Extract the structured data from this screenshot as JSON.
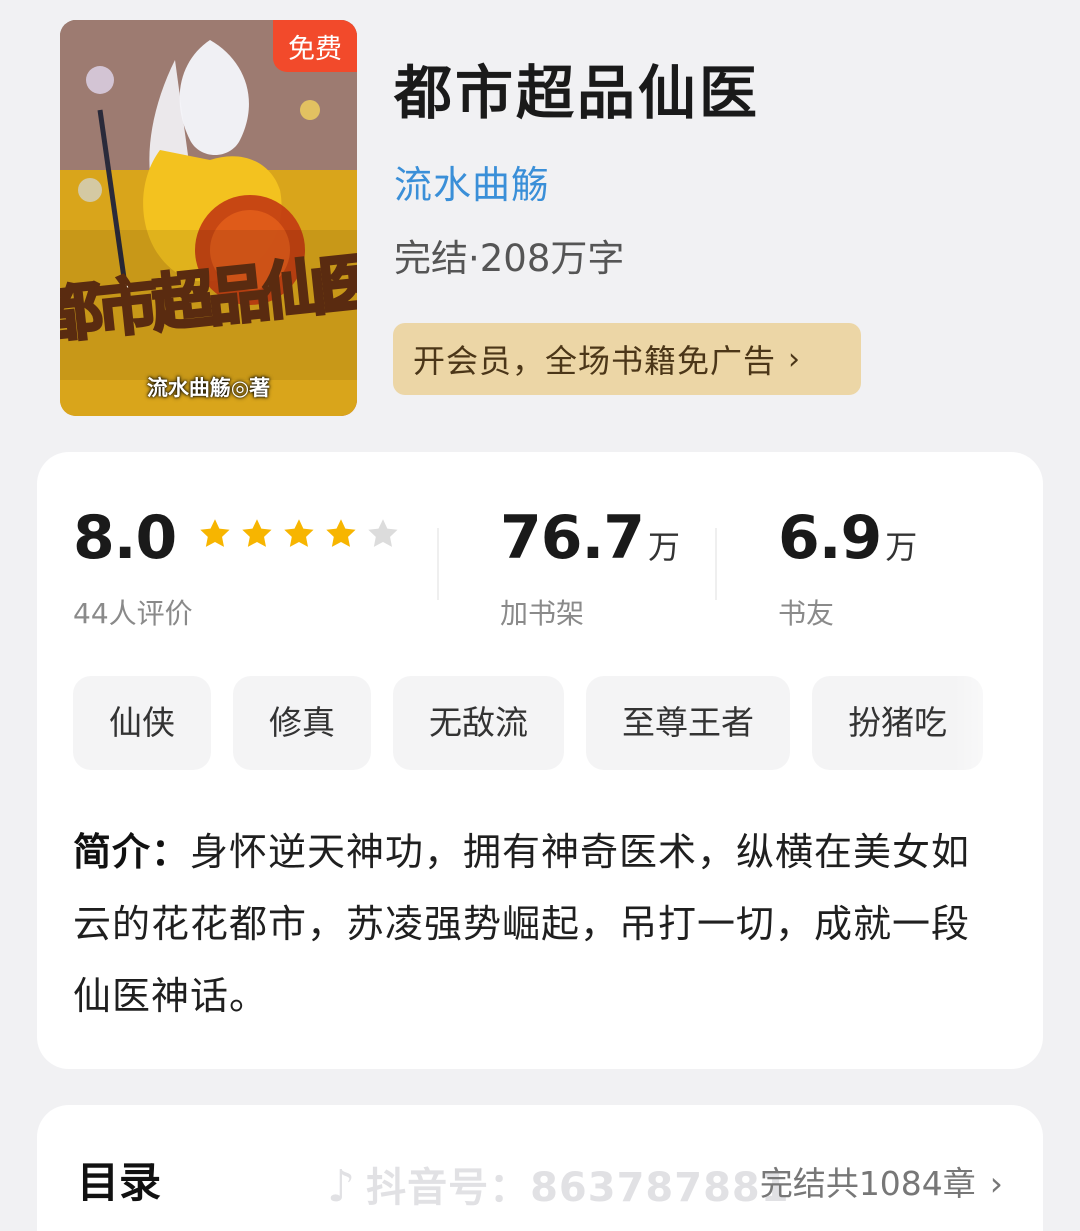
{
  "book": {
    "title": "都市超品仙医",
    "author": "流水曲觞",
    "meta": "完结·208万字",
    "cover": {
      "badge": "免费",
      "art_title": "都市超品仙医",
      "art_author": "流水曲觞◎著"
    }
  },
  "vip_banner": {
    "label": "开会员，全场书籍免广告",
    "chevron": "›",
    "bg_color": "#ecd6a6"
  },
  "stats": {
    "rating": {
      "value": "8.0",
      "stars": 4,
      "max_stars": 5,
      "caption": "44人评价"
    },
    "shelf": {
      "value": "76.7",
      "unit": "万",
      "caption": "加书架"
    },
    "friends": {
      "value": "6.9",
      "unit": "万",
      "caption": "书友"
    }
  },
  "tags": [
    "仙侠",
    "修真",
    "无敌流",
    "至尊王者",
    "扮猪吃"
  ],
  "synopsis": {
    "label": "简介：",
    "text": "身怀逆天神功，拥有神奇医术，纵横在美女如云的花花都市，苏凌强势崛起，吊打一切，成就一段仙医神话。"
  },
  "toc": {
    "title": "目录",
    "status": "完结共1084章",
    "chevron": "›"
  },
  "watermark": {
    "text": "抖音号：863787881",
    "icon": "douyin-logo-icon"
  },
  "colors": {
    "accent_blue": "#3a8fd8",
    "star": "#f7b500",
    "star_empty": "#dcdcdc",
    "badge": "#f24a2b"
  }
}
